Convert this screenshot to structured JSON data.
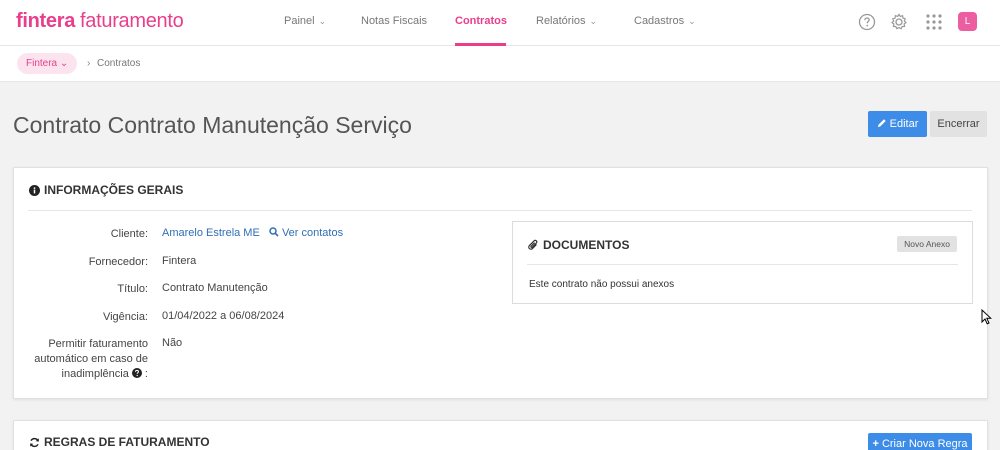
{
  "app": {
    "brand": "fintera",
    "product": "faturamento"
  },
  "nav": {
    "painel": "Painel",
    "notas": "Notas Fiscais",
    "contratos": "Contratos",
    "relatorios": "Relatórios",
    "cadastros": "Cadastros"
  },
  "user": {
    "initial": "L"
  },
  "breadcrumb": {
    "root": "Fintera",
    "current": "Contratos"
  },
  "page": {
    "title": "Contrato Contrato Manutenção Serviço",
    "edit_label": "Editar",
    "close_label": "Encerrar"
  },
  "info": {
    "heading": "INFORMAÇÕES GERAIS",
    "client_label": "Cliente:",
    "client_value": "Amarelo Estrela ME",
    "contacts_link": "Ver contatos",
    "supplier_label": "Fornecedor:",
    "supplier_value": "Fintera",
    "title_label": "Título:",
    "title_value": "Contrato Manutenção",
    "period_label": "Vigência:",
    "period_value": "01/04/2022 a 06/08/2024",
    "autobill_label_1": "Permitir faturamento",
    "autobill_label_2": "automático em caso de",
    "autobill_label_3": "inadimplência",
    "autobill_value": "Não"
  },
  "docs": {
    "heading": "DOCUMENTOS",
    "new_label": "Novo Anexo",
    "empty_text": "Este contrato não possui anexos"
  },
  "rules": {
    "heading": "REGRAS DE FATURAMENTO",
    "create_label": "Criar Nova Regra"
  },
  "colors": {
    "accent": "#e83e8c",
    "primary": "#3d8ce8"
  }
}
